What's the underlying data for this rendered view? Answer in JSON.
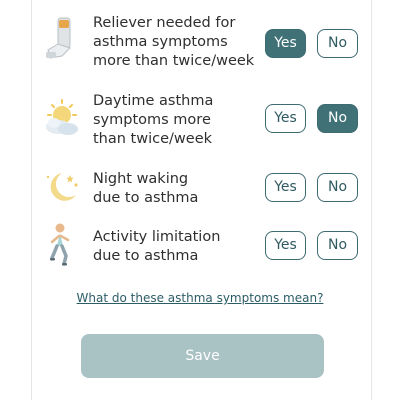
{
  "questions": [
    {
      "label_lines": [
        "Reliever needed for",
        "asthma symptoms",
        "more than twice/week"
      ],
      "yes": "Yes",
      "no": "No",
      "selected": "yes",
      "icon": "inhaler-icon"
    },
    {
      "label_lines": [
        "Daytime asthma",
        "symptoms more",
        "than twice/week"
      ],
      "yes": "Yes",
      "no": "No",
      "selected": "no",
      "icon": "sun-cloud-icon"
    },
    {
      "label_lines": [
        "Night waking",
        "due to asthma"
      ],
      "yes": "Yes",
      "no": "No",
      "selected": "none",
      "icon": "moon-stars-icon"
    },
    {
      "label_lines": [
        "Activity limitation",
        "due to asthma"
      ],
      "yes": "Yes",
      "no": "No",
      "selected": "none",
      "icon": "runner-icon"
    }
  ],
  "help_link": "What do these asthma symptoms mean?",
  "save_label": "Save",
  "colors": {
    "accent": "#3f7177",
    "save_disabled": "#a9c2c4"
  }
}
